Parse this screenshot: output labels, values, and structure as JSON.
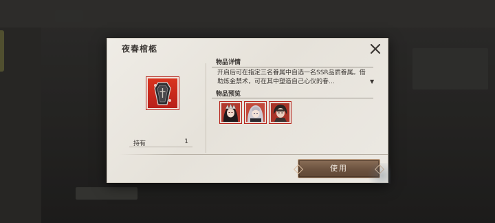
{
  "dialog": {
    "title": "夜春棺柩",
    "close_icon": "close-x-icon",
    "item_icon": "coffin-icon"
  },
  "holdings": {
    "label": "持有",
    "count": "1"
  },
  "details": {
    "header": "物品详情",
    "description": "开启后可在指定三名眷属中自选一名SSR品质眷属。借助炼金禁术，可在其中塑造自己心仪的眷…",
    "expand_icon": "▼"
  },
  "preview": {
    "header": "物品预览",
    "items": [
      {
        "icon": "character-portrait-1"
      },
      {
        "icon": "character-portrait-2"
      },
      {
        "icon": "character-portrait-3"
      }
    ]
  },
  "actions": {
    "use_label": "使用"
  },
  "colors": {
    "item_frame": "#c5281c",
    "button": "#7a5f4a",
    "panel": "#ebe8e2"
  }
}
